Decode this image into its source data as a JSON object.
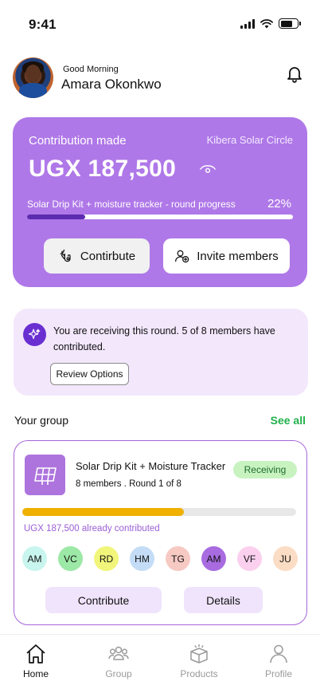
{
  "status_bar": {
    "time": "9:41"
  },
  "header": {
    "greeting": "Good Morning",
    "user_name": "Amara Okonkwo"
  },
  "hero": {
    "label": "Contribution made",
    "group_name": "Kibera Solar Circle",
    "amount": "UGX 187,500",
    "progress_label": "Solar Drip Kit + moisture tracker - round progress",
    "progress_percent_text": "22%",
    "progress_fraction": 0.22,
    "contribute_label": "Contirbute",
    "invite_label": "Invite members"
  },
  "notice": {
    "text": "You are receiving this round. 5 of 8 members have contributed.",
    "button_label": "Review Options"
  },
  "group_section": {
    "title": "Your group",
    "see_all": "See all"
  },
  "group_card": {
    "title": "Solar Drip Kit + Moisture Tracker",
    "meta": "8 members . Round 1 of 8",
    "status": "Receiving",
    "progress_fraction": 0.59,
    "contributed_text": "UGX 187,500 already contributed",
    "members": [
      {
        "initials": "AM",
        "color": "#c8f5ee"
      },
      {
        "initials": "VC",
        "color": "#9ce8a6"
      },
      {
        "initials": "RD",
        "color": "#f1f57a"
      },
      {
        "initials": "HM",
        "color": "#c4dcf6"
      },
      {
        "initials": "TG",
        "color": "#f7c9c3"
      },
      {
        "initials": "AM",
        "color": "#a86be0"
      },
      {
        "initials": "VF",
        "color": "#fbd0ee"
      },
      {
        "initials": "JU",
        "color": "#fbdcc4"
      }
    ],
    "contribute_label": "Contribute",
    "details_label": "Details"
  },
  "tabbar": {
    "tabs": [
      {
        "label": "Home",
        "icon": "home-icon",
        "active": true
      },
      {
        "label": "Group",
        "icon": "group-icon",
        "active": false
      },
      {
        "label": "Products",
        "icon": "package-icon",
        "active": false
      },
      {
        "label": "Profile",
        "icon": "profile-icon",
        "active": false
      }
    ]
  },
  "colors": {
    "accent": "#af78e8",
    "accent_dark": "#6a2fd1",
    "see_all": "#22b14c",
    "progress_yellow": "#efb000"
  }
}
